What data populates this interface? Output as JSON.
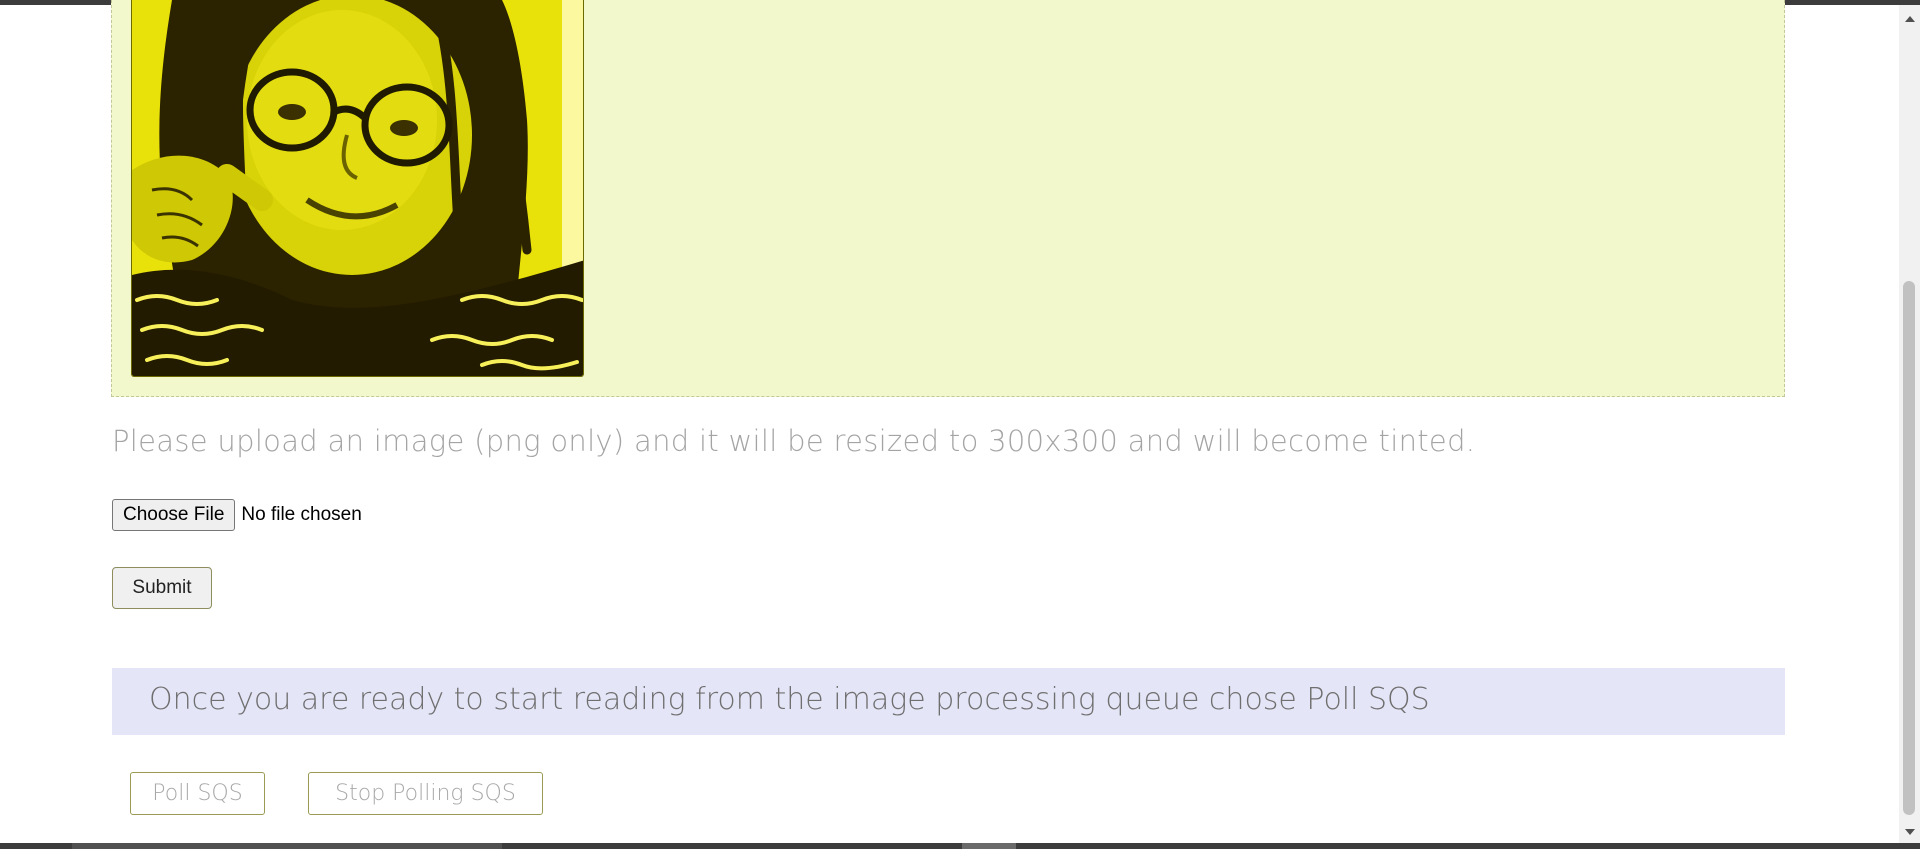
{
  "upload": {
    "instructions": "Please upload an image (png only) and it will be resized to 300x300 and will become tinted.",
    "choose_file_label": "Choose File",
    "file_status": "No file chosen",
    "submit_label": "Submit"
  },
  "queue": {
    "banner_text": "Once you are ready to start reading from the image processing queue chose Poll SQS",
    "poll_label": "Poll SQS",
    "stop_label": "Stop Polling SQS"
  },
  "colors": {
    "image_box_bg": "#f3f7cc",
    "photo_tint": "#f2ee12",
    "banner_bg": "#e4e5f7",
    "button_border": "#9a9a55"
  },
  "icons": {
    "scroll_up": "scroll-up-arrow-icon",
    "scroll_down": "scroll-down-arrow-icon"
  }
}
